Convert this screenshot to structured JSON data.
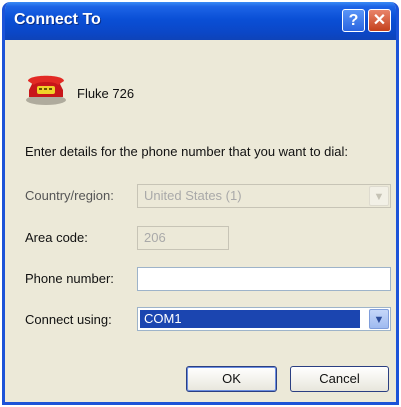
{
  "window": {
    "title": "Connect To"
  },
  "titlebar_buttons": {
    "help": "?",
    "close": "✕"
  },
  "connection": {
    "name": "Fluke 726",
    "icon": "phone-icon"
  },
  "prompt": "Enter details for the phone number that you want to dial:",
  "fields": {
    "country": {
      "label": "Country/region:",
      "value": "United States (1)",
      "enabled": false
    },
    "area_code": {
      "label": "Area code:",
      "value": "206",
      "enabled": false
    },
    "phone": {
      "label": "Phone number:",
      "value": "",
      "enabled": true
    },
    "connect_using": {
      "label": "Connect using:",
      "value": "COM1",
      "enabled": true
    }
  },
  "buttons": {
    "ok": "OK",
    "cancel": "Cancel"
  },
  "colors": {
    "titlebar": "#0b47c7",
    "selection": "#1b45b0",
    "dialog_bg": "#ece9d8"
  }
}
